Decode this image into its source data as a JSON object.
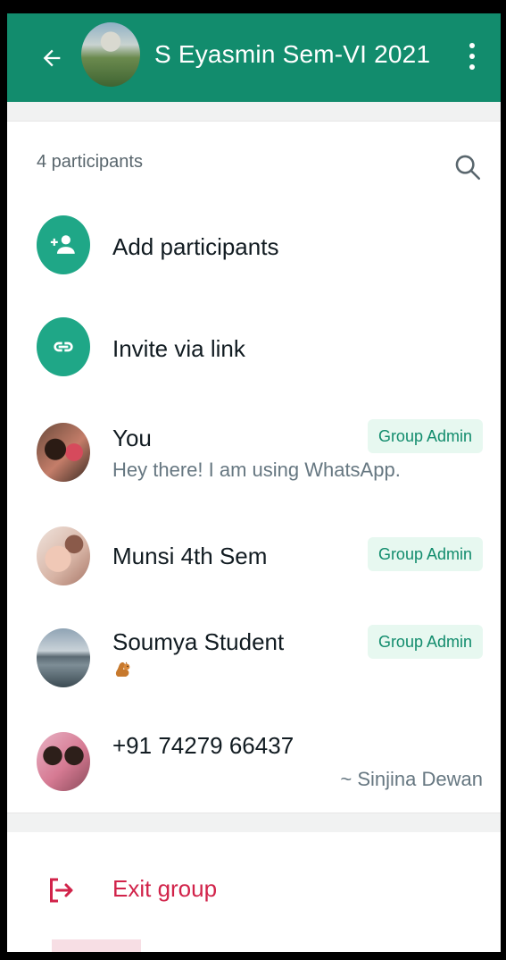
{
  "header": {
    "back_icon": "arrow-left-icon",
    "group_name": "S Eyasmin Sem-VI 2021",
    "more_icon": "more-vertical-icon",
    "color": "#128c6d"
  },
  "participants": {
    "count_label": "4 participants",
    "search_icon": "search-icon"
  },
  "actions": {
    "add_participants": "Add participants",
    "invite_via_link": "Invite via link",
    "accent": "#1fa787"
  },
  "members": [
    {
      "name": "You",
      "status": "Hey there! I am using WhatsApp.",
      "badge": "Group Admin"
    },
    {
      "name": "Munsi 4th Sem",
      "status": "",
      "badge": "Group Admin"
    },
    {
      "name": "Soumya Student",
      "status_icon": "squirrel-emoji",
      "badge": "Group Admin"
    },
    {
      "name": "+91 74279 66437",
      "pushname": "~ Sinjina Dewan"
    }
  ],
  "footer": {
    "exit_group": "Exit group",
    "exit_color": "#d1234a"
  }
}
